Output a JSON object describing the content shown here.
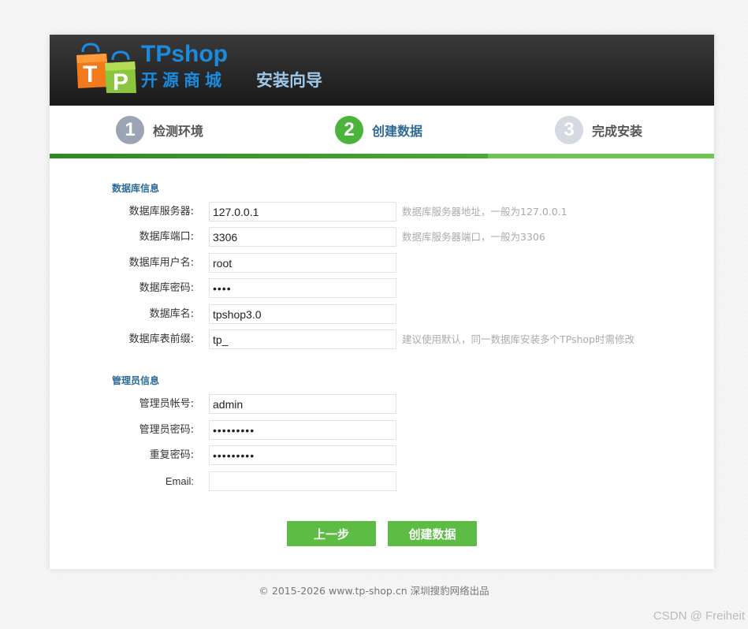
{
  "header": {
    "brand_en": "TPshop",
    "brand_cn": "开源商城",
    "title": "安装向导"
  },
  "steps": [
    {
      "number": "1",
      "label": "检测环境",
      "state": "done"
    },
    {
      "number": "2",
      "label": "创建数据",
      "state": "active"
    },
    {
      "number": "3",
      "label": "完成安装",
      "state": "pending"
    }
  ],
  "colors": {
    "step_done": "#9aa4b4",
    "step_active": "#4cb43a",
    "step_pending": "#d4d9e2",
    "button": "#5cbc44",
    "section_title": "#2d6b96"
  },
  "database": {
    "section_title": "数据库信息",
    "fields": [
      {
        "label": "数据库服务器:",
        "value": "127.0.0.1",
        "hint": "数据库服务器地址，一般为127.0.0.1",
        "type": "text"
      },
      {
        "label": "数据库端口:",
        "value": "3306",
        "hint": "数据库服务器端口，一般为3306",
        "type": "text"
      },
      {
        "label": "数据库用户名:",
        "value": "root",
        "hint": "",
        "type": "text"
      },
      {
        "label": "数据库密码:",
        "value": "••••",
        "hint": "",
        "type": "password"
      },
      {
        "label": "数据库名:",
        "value": "tpshop3.0",
        "hint": "",
        "type": "text"
      },
      {
        "label": "数据库表前缀:",
        "value": "tp_",
        "hint": "建议使用默认，同一数据库安装多个TPshop时需修改",
        "type": "text"
      }
    ]
  },
  "admin": {
    "section_title": "管理员信息",
    "fields": [
      {
        "label": "管理员帐号:",
        "value": "admin",
        "type": "text"
      },
      {
        "label": "管理员密码:",
        "value": "•••••••••",
        "type": "password"
      },
      {
        "label": "重复密码:",
        "value": "•••••••••",
        "type": "password"
      },
      {
        "label": "Email:",
        "value": "",
        "type": "text"
      }
    ]
  },
  "buttons": {
    "prev": "上一步",
    "create": "创建数据"
  },
  "footer": {
    "text": "© 2015-2026 www.tp-shop.cn 深圳搜豹网络出品"
  },
  "watermark": "CSDN @ Freiheit"
}
